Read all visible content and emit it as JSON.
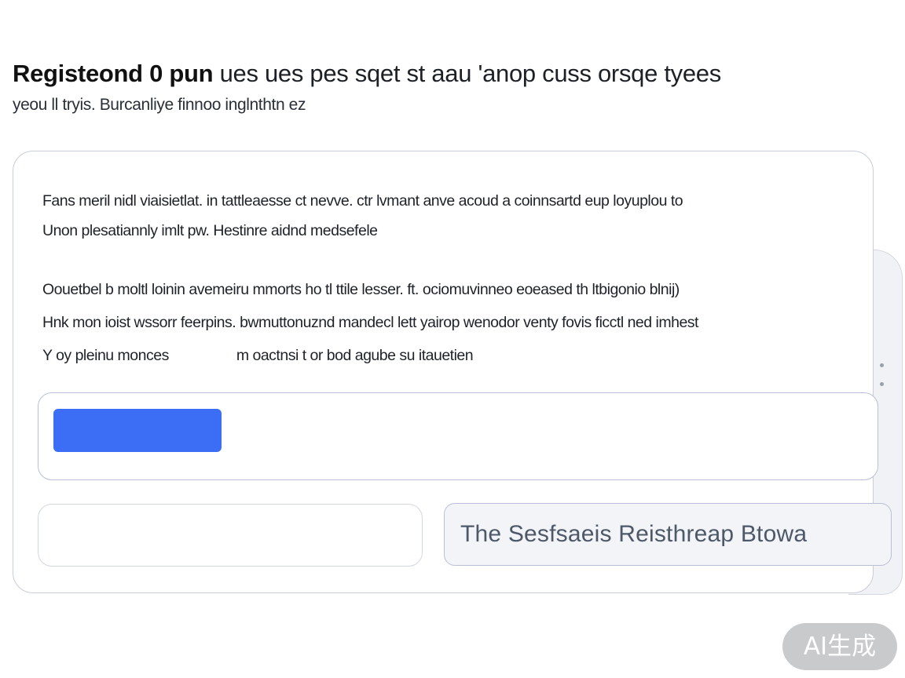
{
  "header": {
    "title_bold": "Registeond 0 pun",
    "title_rest": "ues ues pes sqet st aau 'anop cuss orsqe tyees",
    "subtitle": "yeou ll tryis. Burcanliye finnoo inglnthtn ez"
  },
  "card": {
    "paragraph_1": [
      "Fans meril nidl viaisietlat. in tattleaesse ct nevve. ctr lvmant anve acoud a coinnsartd eup loyuplou to",
      "Unon plesatiannly imlt pw. Hestinre aidnd medsefele"
    ],
    "paragraph_2": [
      "Oouetbel b moltl loinin avemeiru mmorts ho tl ttile lesser. ft. ociomuvinneo eoeased th ltbigonio blnij)",
      "Hnk mon ioist wssorr feerpins. bwmuttonuznd mandecl lett yairop wenodor venty fovis ficctl ned imhest",
      "Y oy pleinu monces",
      "m oactnsi t or bod agube su itauetien"
    ]
  },
  "actions": {
    "primary_button_label": "",
    "left_field_value": "",
    "secondary_button_label": "The Sesfsaeis Reisthreap Btowa"
  },
  "watermark": "AI生成",
  "colors": {
    "primary_accent": "#3b6ef4",
    "border": "#c9cdd8",
    "secondary_button_bg": "#f3f4f7",
    "secondary_button_text": "#4d5869"
  },
  "icons": {
    "card_side_dots": "dot"
  }
}
